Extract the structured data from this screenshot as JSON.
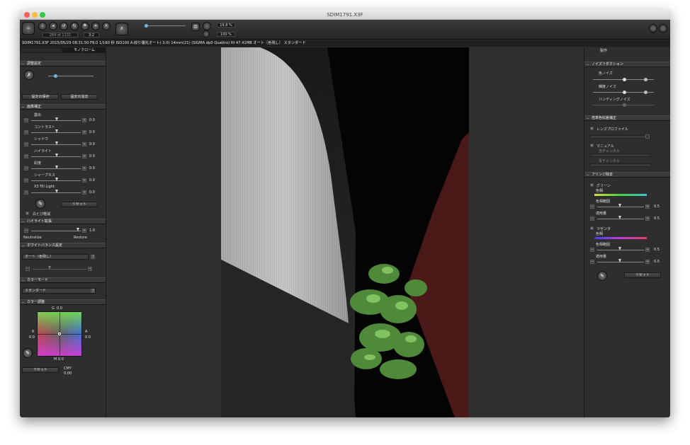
{
  "window": {
    "title": "SDIM1791.X3F"
  },
  "toolbar": {
    "image_count": "284 of 1131",
    "ratio": "3:2",
    "zoom_top": "19.8 %",
    "zoom_bottom": "100 %"
  },
  "infobar": {
    "text": "SDIM1791.X3F 2015/05/29 08:31:50 F8.0 1/160 秒 ISO100 A:絞り優先オート(-3.0) 14mm(21) (SIGMA dp0 Quattro) HI 47.41MB オート（色残し） スタンダード"
  },
  "left": {
    "tabs": [
      "",
      "モノクローム"
    ],
    "adjust": {
      "header": "調整設定",
      "save": "設定の保存",
      "clear": "設定の消去"
    },
    "image": {
      "header": "画像補正",
      "sliders": [
        {
          "label": "露出",
          "value": "0.0"
        },
        {
          "label": "コントラスト",
          "value": "0.0"
        },
        {
          "label": "シャドウ",
          "value": "0.0"
        },
        {
          "label": "ハイライト",
          "value": "0.0"
        },
        {
          "label": "彩度",
          "value": "0.0"
        },
        {
          "label": "シャープネス",
          "value": "0.0"
        },
        {
          "label": "X3 Fill Light",
          "value": "0.0"
        }
      ],
      "reset": "リセット",
      "whiteout": "白とび軽減"
    },
    "highlight": {
      "header": "ハイライト拡張",
      "value": "1.0",
      "left_label": "Neutralize",
      "right_label": "Restore"
    },
    "wb": {
      "header": "ホワイトバランス設定",
      "mode": "オート（色残し）"
    },
    "colormode": {
      "header": "カラーモード",
      "mode": "スタンダード"
    },
    "coloradj": {
      "header": "カラー調整",
      "g_label": "G",
      "g_value": "0.0",
      "r_label": "R",
      "r_value": "0.0",
      "a_label": "A",
      "a_value": "0.0",
      "m_label": "M",
      "m_value": "0.0",
      "reset": "リセット",
      "cmy_label": "CMY",
      "cmy_value": "0.00"
    }
  },
  "right": {
    "tab": "製作",
    "noise": {
      "header": "ノイズリダクション",
      "color": "色ノイズ",
      "lum": "輝度ノイズ",
      "band": "バンディングノイズ"
    },
    "lens": {
      "header": "倍率色収差補正",
      "profile": "レンズプロファイル",
      "manual": "マニュアル",
      "red": "赤チャンネル",
      "blue": "青チャンネル"
    },
    "fringe": {
      "header": "フリンジ除去",
      "green": "グリーン",
      "hue1": "色相",
      "range1": "色相範囲",
      "range1_val": "0.5",
      "amt1": "適用量",
      "amt1_val": "0.5",
      "magenta": "マゼンタ",
      "hue2": "色相",
      "range2": "色相範囲",
      "range2_val": "0.5",
      "amt2": "適用量",
      "amt2_val": "0.5",
      "reset": "リセット"
    }
  }
}
